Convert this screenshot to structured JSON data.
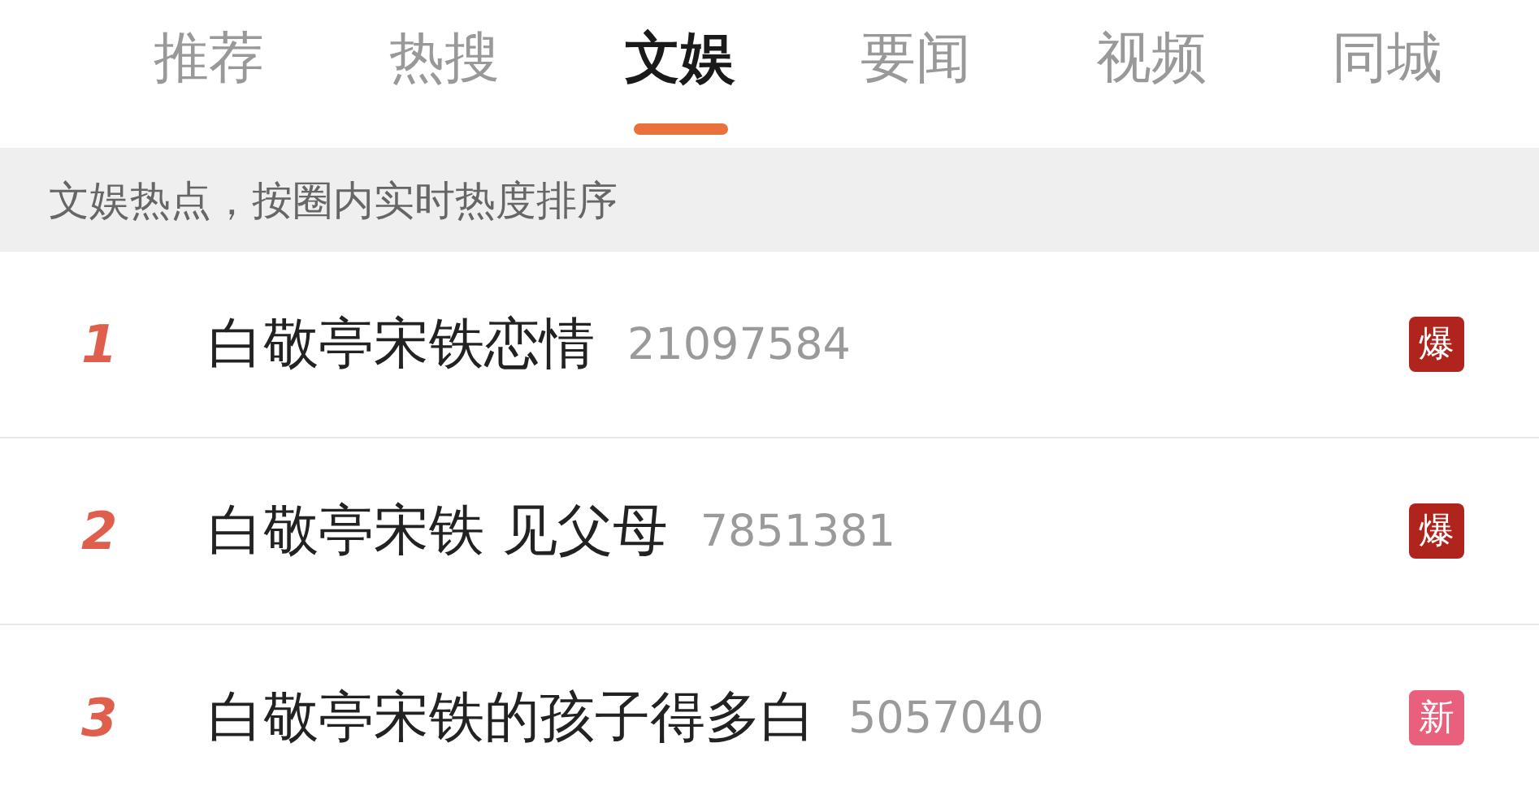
{
  "tabs": [
    {
      "label": "推荐",
      "selected": false
    },
    {
      "label": "热搜",
      "selected": false
    },
    {
      "label": "文娱",
      "selected": true
    },
    {
      "label": "要闻",
      "selected": false
    },
    {
      "label": "视频",
      "selected": false
    },
    {
      "label": "同城",
      "selected": false
    }
  ],
  "banner": "文娱热点，按圈内实时热度排序",
  "items": [
    {
      "rank": "1",
      "title": "白敬亭宋铁恋情",
      "count": "21097584",
      "badge": {
        "kind": "hot",
        "label": "爆"
      }
    },
    {
      "rank": "2",
      "title": "白敬亭宋铁 见父母",
      "count": "7851381",
      "badge": {
        "kind": "hot",
        "label": "爆"
      }
    },
    {
      "rank": "3",
      "title": "白敬亭宋铁的孩子得多白",
      "count": "5057040",
      "badge": {
        "kind": "new",
        "label": "新"
      }
    }
  ]
}
